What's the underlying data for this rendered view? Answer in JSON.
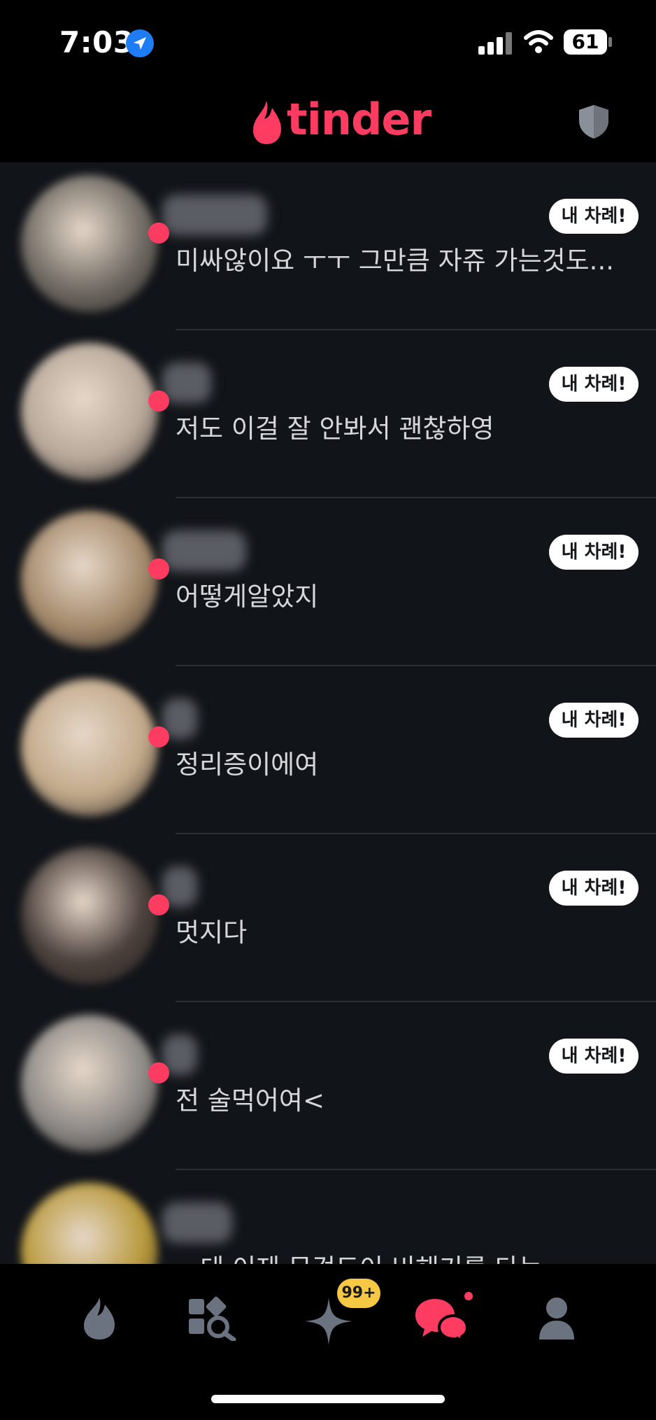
{
  "status_bar": {
    "time": "7:03",
    "battery": "61",
    "icons": [
      "location-arrow-icon",
      "signal-icon",
      "wifi-icon",
      "battery-icon"
    ]
  },
  "header": {
    "logo_text": "tinder",
    "brand_color": "#fe3c62",
    "shield_icon": "shield-icon"
  },
  "matches": [
    {
      "message": "미싸않이요 ㅜㅜ 그만큼 자쥬 가는것도...",
      "badge": "내 차례!",
      "avatar_color": "#6f6a63",
      "name_width": 150
    },
    {
      "message": "저도 이걸 잘 안봐서 괜찮하영",
      "badge": "내 차례!",
      "avatar_color": "#b8a89a",
      "name_width": 70
    },
    {
      "message": "어떻게알았지",
      "badge": "내 차례!",
      "avatar_color": "#a58a6c",
      "name_width": 120
    },
    {
      "message": "정리증이에여",
      "badge": "내 차례!",
      "avatar_color": "#c2a98a",
      "name_width": 50
    },
    {
      "message": "멋지다",
      "badge": "내 차례!",
      "avatar_color": "#4a3f3b",
      "name_width": 50
    },
    {
      "message": "전 술먹어여<",
      "badge": "내 차례!",
      "avatar_color": "#8e8a87",
      "name_width": 50
    },
    {
      "message": "...데 이제 무겁도이 비해기를 타는",
      "badge": "",
      "avatar_color": "#b99a3d",
      "name_width": 100
    }
  ],
  "bottom_nav": {
    "items": [
      "flame-icon",
      "explore-icon",
      "sparkle-icon",
      "chat-icon",
      "profile-icon"
    ],
    "sparkle_badge": "99+",
    "active_color": "#fe3c62",
    "inactive_color": "#6b7280"
  }
}
